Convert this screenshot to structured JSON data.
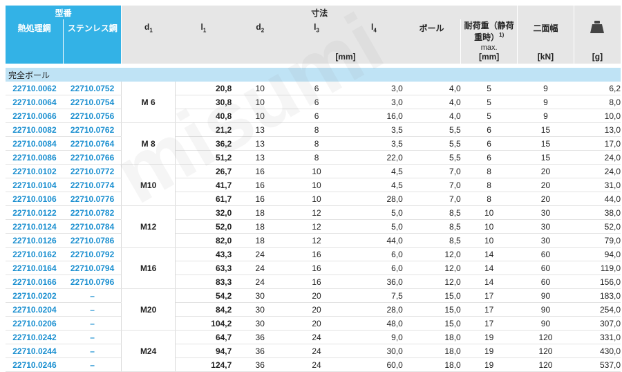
{
  "headers": {
    "part_number": "型番",
    "heat_treated": "熱処理鋼",
    "stainless": "ステンレス鋼",
    "dimensions": "寸法",
    "d1": "d",
    "d1_sub": "1",
    "l1": "l",
    "l1_sub": "1",
    "d2": "d",
    "d2_sub": "2",
    "l3": "l",
    "l3_sub": "3",
    "l4": "l",
    "l4_sub": "4",
    "ball": "ボール",
    "width_across": "二面幅",
    "load": "耐荷重（静荷重時）",
    "load_sup": "1)",
    "load_max": "max.",
    "unit_mm": "[mm]",
    "unit_mm2": "[mm]",
    "unit_kn": "[kN]",
    "unit_g": "[g]"
  },
  "section_label": "完全ボール",
  "watermark": "misumi",
  "rows": [
    {
      "a": "22710.0062",
      "b": "22710.0752",
      "size": "M 6",
      "l1": "20,8",
      "d2": "10",
      "l3": "6",
      "l4": "3,0",
      "ball": "4,0",
      "sw": "5",
      "load": "9",
      "w": "6,2"
    },
    {
      "a": "22710.0064",
      "b": "22710.0754",
      "size": "",
      "l1": "30,8",
      "d2": "10",
      "l3": "6",
      "l4": "3,0",
      "ball": "4,0",
      "sw": "5",
      "load": "9",
      "w": "8,0"
    },
    {
      "a": "22710.0066",
      "b": "22710.0756",
      "size": "",
      "l1": "40,8",
      "d2": "10",
      "l3": "6",
      "l4": "16,0",
      "ball": "4,0",
      "sw": "5",
      "load": "9",
      "w": "10,0"
    },
    {
      "a": "22710.0082",
      "b": "22710.0762",
      "size": "M 8",
      "l1": "21,2",
      "d2": "13",
      "l3": "8",
      "l4": "3,5",
      "ball": "5,5",
      "sw": "6",
      "load": "15",
      "w": "13,0"
    },
    {
      "a": "22710.0084",
      "b": "22710.0764",
      "size": "",
      "l1": "36,2",
      "d2": "13",
      "l3": "8",
      "l4": "3,5",
      "ball": "5,5",
      "sw": "6",
      "load": "15",
      "w": "17,0"
    },
    {
      "a": "22710.0086",
      "b": "22710.0766",
      "size": "",
      "l1": "51,2",
      "d2": "13",
      "l3": "8",
      "l4": "22,0",
      "ball": "5,5",
      "sw": "6",
      "load": "15",
      "w": "24,0"
    },
    {
      "a": "22710.0102",
      "b": "22710.0772",
      "size": "M10",
      "l1": "26,7",
      "d2": "16",
      "l3": "10",
      "l4": "4,5",
      "ball": "7,0",
      "sw": "8",
      "load": "20",
      "w": "24,0"
    },
    {
      "a": "22710.0104",
      "b": "22710.0774",
      "size": "",
      "l1": "41,7",
      "d2": "16",
      "l3": "10",
      "l4": "4,5",
      "ball": "7,0",
      "sw": "8",
      "load": "20",
      "w": "31,0"
    },
    {
      "a": "22710.0106",
      "b": "22710.0776",
      "size": "",
      "l1": "61,7",
      "d2": "16",
      "l3": "10",
      "l4": "28,0",
      "ball": "7,0",
      "sw": "8",
      "load": "20",
      "w": "44,0"
    },
    {
      "a": "22710.0122",
      "b": "22710.0782",
      "size": "M12",
      "l1": "32,0",
      "d2": "18",
      "l3": "12",
      "l4": "5,0",
      "ball": "8,5",
      "sw": "10",
      "load": "30",
      "w": "38,0"
    },
    {
      "a": "22710.0124",
      "b": "22710.0784",
      "size": "",
      "l1": "52,0",
      "d2": "18",
      "l3": "12",
      "l4": "5,0",
      "ball": "8,5",
      "sw": "10",
      "load": "30",
      "w": "52,0"
    },
    {
      "a": "22710.0126",
      "b": "22710.0786",
      "size": "",
      "l1": "82,0",
      "d2": "18",
      "l3": "12",
      "l4": "44,0",
      "ball": "8,5",
      "sw": "10",
      "load": "30",
      "w": "79,0"
    },
    {
      "a": "22710.0162",
      "b": "22710.0792",
      "size": "M16",
      "l1": "43,3",
      "d2": "24",
      "l3": "16",
      "l4": "6,0",
      "ball": "12,0",
      "sw": "14",
      "load": "60",
      "w": "94,0"
    },
    {
      "a": "22710.0164",
      "b": "22710.0794",
      "size": "",
      "l1": "63,3",
      "d2": "24",
      "l3": "16",
      "l4": "6,0",
      "ball": "12,0",
      "sw": "14",
      "load": "60",
      "w": "119,0"
    },
    {
      "a": "22710.0166",
      "b": "22710.0796",
      "size": "",
      "l1": "83,3",
      "d2": "24",
      "l3": "16",
      "l4": "36,0",
      "ball": "12,0",
      "sw": "14",
      "load": "60",
      "w": "156,0"
    },
    {
      "a": "22710.0202",
      "b": "–",
      "size": "M20",
      "l1": "54,2",
      "d2": "30",
      "l3": "20",
      "l4": "7,5",
      "ball": "15,0",
      "sw": "17",
      "load": "90",
      "w": "183,0"
    },
    {
      "a": "22710.0204",
      "b": "–",
      "size": "",
      "l1": "84,2",
      "d2": "30",
      "l3": "20",
      "l4": "28,0",
      "ball": "15,0",
      "sw": "17",
      "load": "90",
      "w": "254,0"
    },
    {
      "a": "22710.0206",
      "b": "–",
      "size": "",
      "l1": "104,2",
      "d2": "30",
      "l3": "20",
      "l4": "48,0",
      "ball": "15,0",
      "sw": "17",
      "load": "90",
      "w": "307,0"
    },
    {
      "a": "22710.0242",
      "b": "–",
      "size": "M24",
      "l1": "64,7",
      "d2": "36",
      "l3": "24",
      "l4": "9,0",
      "ball": "18,0",
      "sw": "19",
      "load": "120",
      "w": "331,0"
    },
    {
      "a": "22710.0244",
      "b": "–",
      "size": "",
      "l1": "94,7",
      "d2": "36",
      "l3": "24",
      "l4": "30,0",
      "ball": "18,0",
      "sw": "19",
      "load": "120",
      "w": "430,0"
    },
    {
      "a": "22710.0246",
      "b": "–",
      "size": "",
      "l1": "124,7",
      "d2": "36",
      "l3": "24",
      "l4": "60,0",
      "ball": "18,0",
      "sw": "19",
      "load": "120",
      "w": "537,0"
    }
  ]
}
